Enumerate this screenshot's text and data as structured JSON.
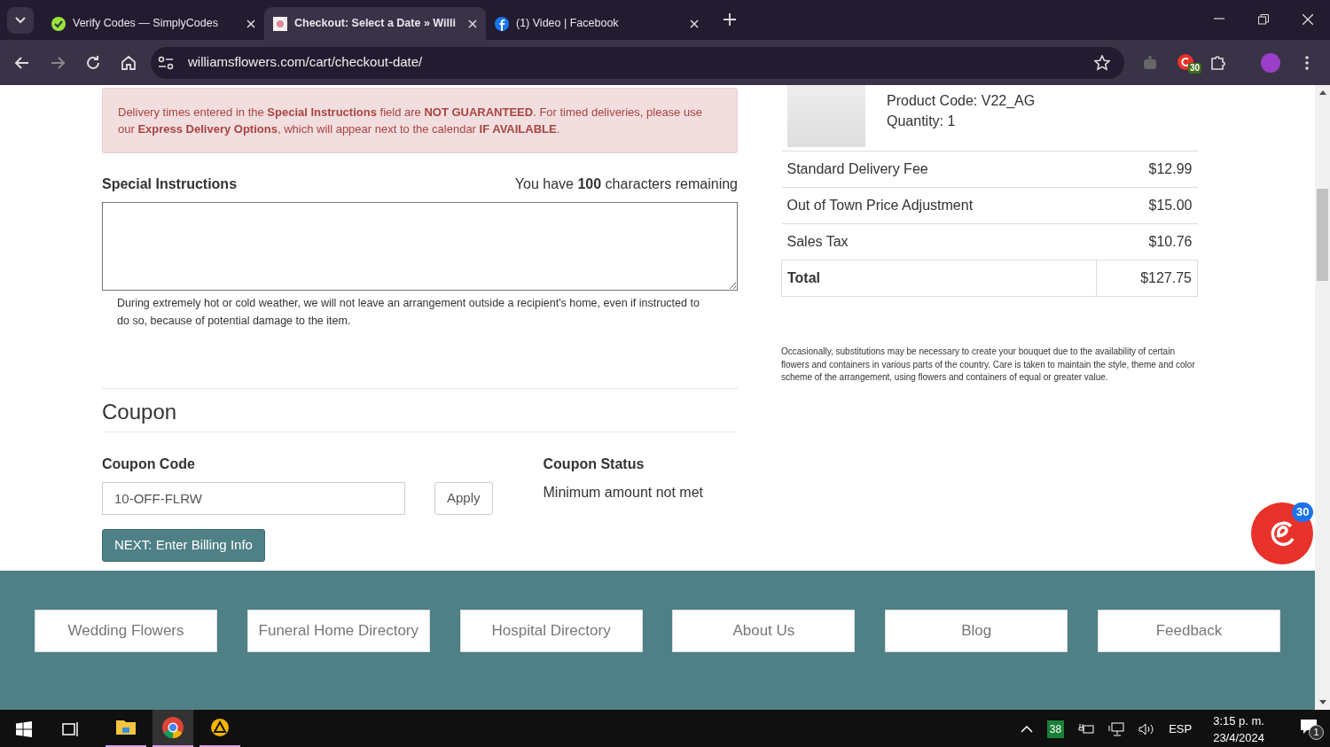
{
  "browser": {
    "tabs": [
      {
        "title": "Verify Codes — SimplyCodes",
        "selected": false,
        "kind": "green"
      },
      {
        "title": "Checkout: Select a Date » Willi",
        "selected": true,
        "kind": "flower"
      },
      {
        "title": "(1) Video | Facebook",
        "selected": false,
        "kind": "facebook"
      }
    ],
    "address": "williamsflowers.com/cart/checkout-date/",
    "extension_badge": "30"
  },
  "alert": "Delivery times entered in the **Special Instructions** field are **NOT GUARANTEED**. For timed deliveries, please use our **Express Delivery Options**, which will appear next to the calendar **IF AVAILABLE**.",
  "special_instructions": {
    "label": "Special Instructions",
    "counter": "You have **100** characters remaining",
    "note": "During extremely hot or cold weather, we will not leave an arrangement outside a recipient's home, even if instructed to do so, because of potential damage to the item."
  },
  "coupon": {
    "heading": "Coupon",
    "code_label": "Coupon Code",
    "code_value": "10-OFF-FLRW",
    "apply_button": "Apply",
    "status_label": "Coupon Status",
    "status_text": "Minimum amount not met",
    "next_button": "NEXT: Enter Billing Info"
  },
  "order": {
    "product_code": "Product Code: V22_AG",
    "quantity": "Quantity: 1",
    "rows": [
      {
        "label": "Standard Delivery Fee",
        "amount": "$12.99",
        "kind": "line"
      },
      {
        "label": "Out of Town Price Adjustment",
        "amount": "$15.00",
        "kind": "line"
      },
      {
        "label": "Sales Tax",
        "amount": "$10.76",
        "kind": "line"
      },
      {
        "label": "Total",
        "amount": "$127.75",
        "kind": "total"
      }
    ],
    "disclaimer": "Occasionally, substitutions may be necessary to create your bouquet due to the availability of certain flowers and containers in various parts of the country. Care is taken to maintain the style, theme and color scheme of the arrangement, using flowers and containers of equal or greater value."
  },
  "floating_badge": "30",
  "footer_links": [
    "Wedding Flowers",
    "Funeral Home Directory",
    "Hospital Directory",
    "About Us",
    "Blog",
    "Feedback"
  ],
  "taskbar": {
    "apps": [
      {
        "kind": "explorer",
        "selected": false
      },
      {
        "kind": "chrome",
        "selected": true
      },
      {
        "kind": "triangle",
        "selected": false
      }
    ],
    "temperature": "38",
    "language": "ESP",
    "time": "3:15 p. m.",
    "date": "23/4/2024",
    "notifications": "1"
  }
}
